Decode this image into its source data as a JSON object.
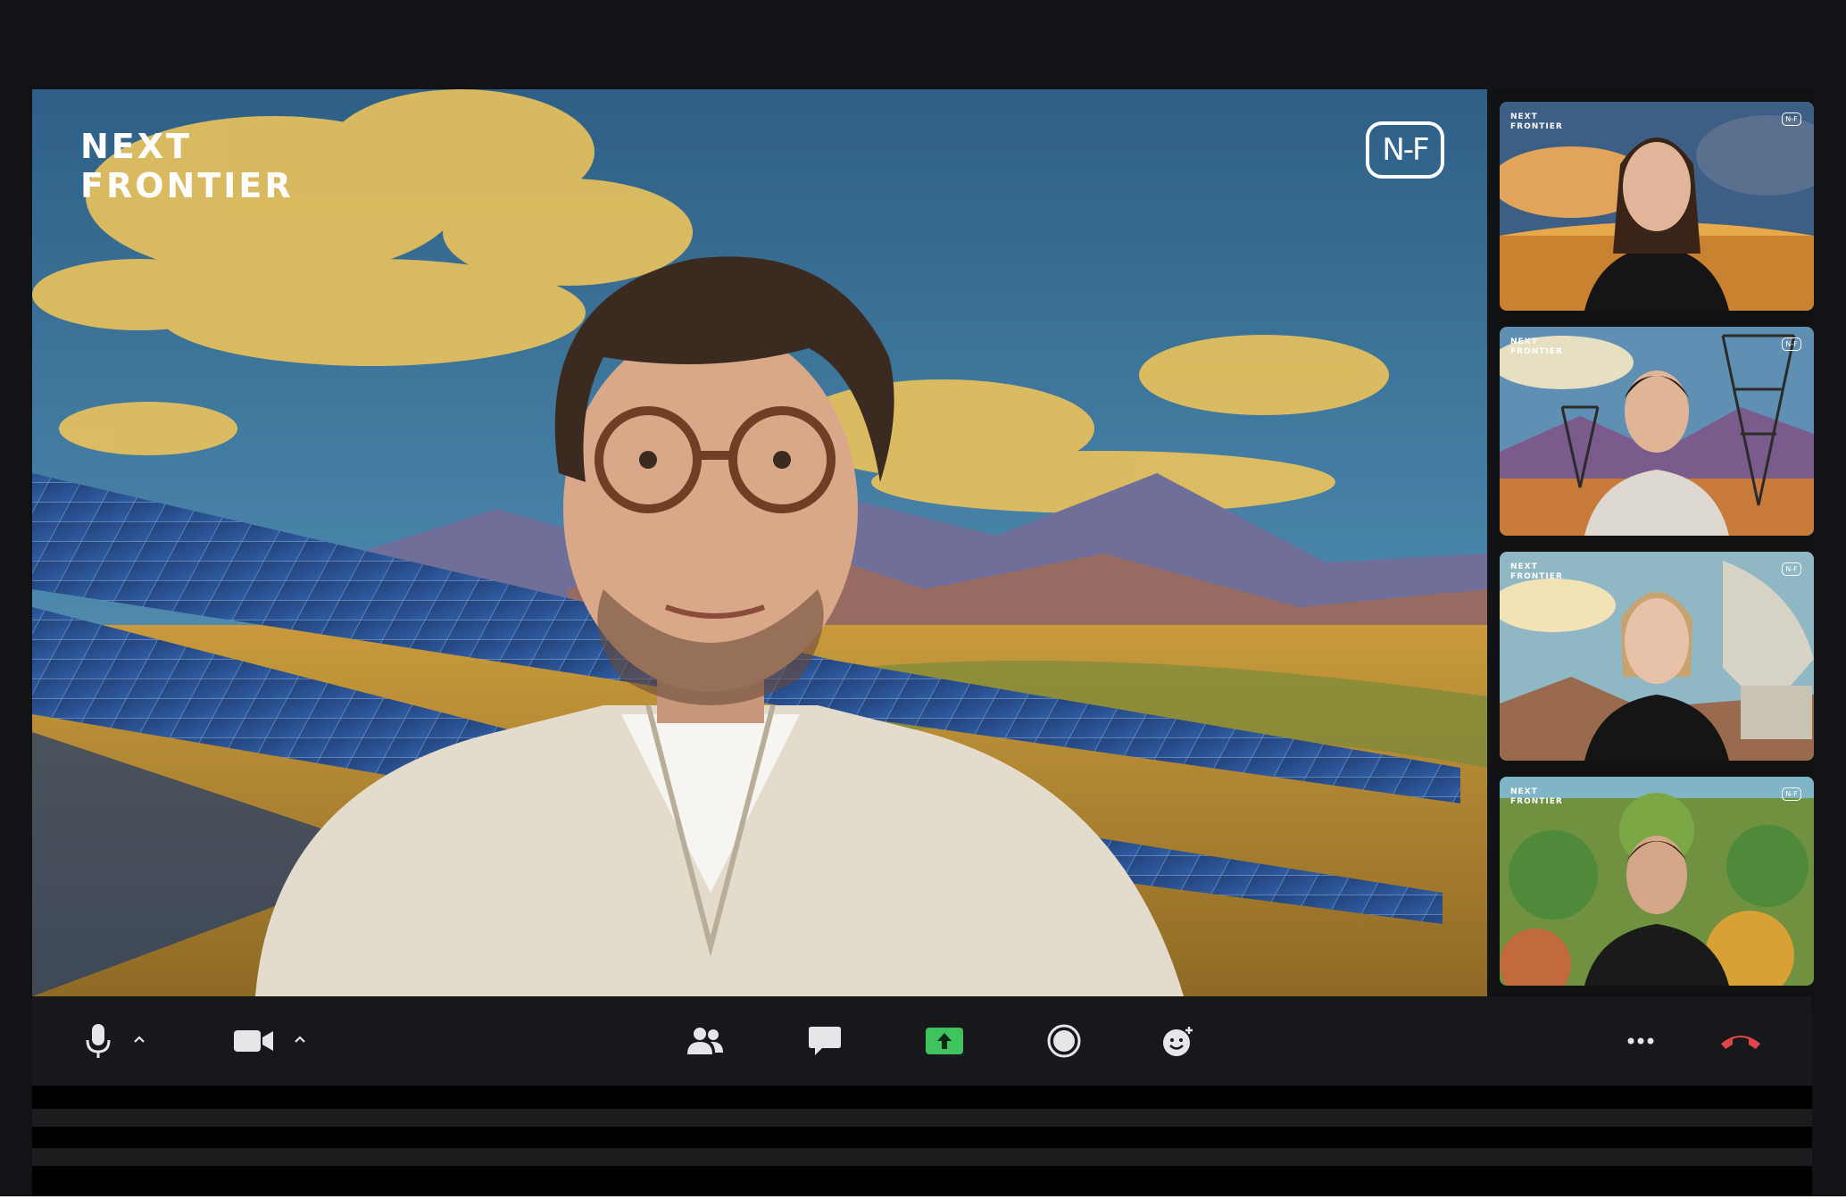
{
  "main": {
    "brand_line1": "NEXT",
    "brand_line2": "FRONTIER",
    "badge": "N-F"
  },
  "participants": [
    {
      "id": "p1",
      "brand_line1": "NEXT",
      "brand_line2": "FRONTIER",
      "badge": "N-F"
    },
    {
      "id": "p2",
      "brand_line1": "NEXT",
      "brand_line2": "FRONTIER",
      "badge": "N-F"
    },
    {
      "id": "p3",
      "brand_line1": "NEXT",
      "brand_line2": "FRONTIER",
      "badge": "N-F"
    },
    {
      "id": "p4",
      "brand_line1": "NEXT",
      "brand_line2": "FRONTIER",
      "badge": "N-F"
    }
  ],
  "toolbar": {
    "icons": [
      "microphone-icon",
      "video-camera-icon",
      "participants-icon",
      "chat-icon",
      "share-screen-icon",
      "record-icon",
      "reactions-icon",
      "more-icon",
      "leave-call-icon"
    ]
  },
  "colors": {
    "share_green": "#3fc35f",
    "leave_red": "#e0454a",
    "toolbar_bg": "#17181b",
    "icon": "#e6e6e8"
  }
}
